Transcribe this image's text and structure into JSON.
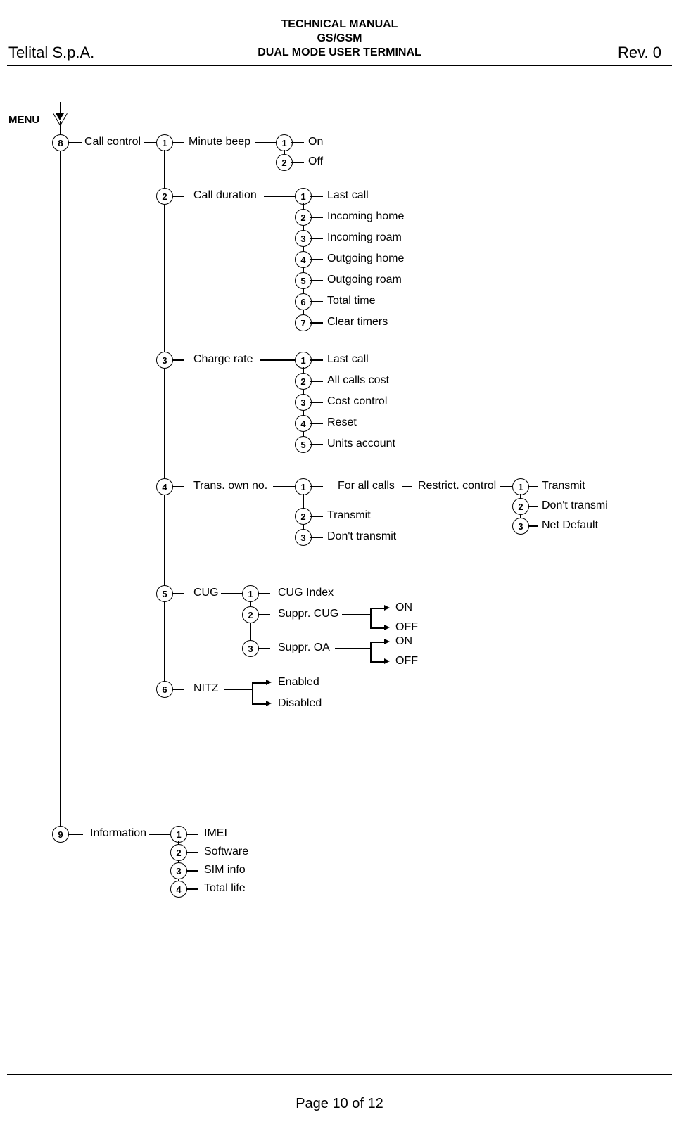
{
  "header": {
    "company": "Telital S.p.A.",
    "title1": "TECHNICAL MANUAL",
    "title2": "GS/GSM",
    "title3": "DUAL MODE USER TERMINAL",
    "rev": "Rev. 0"
  },
  "footer": {
    "page": "Page 10 of 12"
  },
  "menu_label": "MENU",
  "tree": {
    "n8": "8",
    "n8_label": "Call control",
    "cc1": "1",
    "cc1_label": "Minute beep",
    "mb1": "1",
    "mb1_label": "On",
    "mb2": "2",
    "mb2_label": "Off",
    "cc2": "2",
    "cc2_label": "Call duration",
    "cd1": "1",
    "cd1_label": "Last call",
    "cd2": "2",
    "cd2_label": "Incoming home",
    "cd3": "3",
    "cd3_label": "Incoming roam",
    "cd4": "4",
    "cd4_label": "Outgoing home",
    "cd5": "5",
    "cd5_label": "Outgoing roam",
    "cd6": "6",
    "cd6_label": "Total time",
    "cd7": "7",
    "cd7_label": "Clear timers",
    "cc3": "3",
    "cc3_label": "Charge rate",
    "cr1": "1",
    "cr1_label": "Last call",
    "cr2": "2",
    "cr2_label": "All calls cost",
    "cr3": "3",
    "cr3_label": "Cost control",
    "cr4": "4",
    "cr4_label": "Reset",
    "cr5": "5",
    "cr5_label": "Units account",
    "cc4": "4",
    "cc4_label": "Trans. own no.",
    "to1": "1",
    "to1_label": "For all calls",
    "to1_ext": "Restrict. control",
    "rc1": "1",
    "rc1_label": "Transmit",
    "rc2": "2",
    "rc2_label": "Don't transmi",
    "rc3": "3",
    "rc3_label": "Net Default",
    "to2": "2",
    "to2_label": "Transmit",
    "to3": "3",
    "to3_label": "Don't transmit",
    "cc5": "5",
    "cc5_label": "CUG",
    "cu1": "1",
    "cu1_label": "CUG Index",
    "cu2": "2",
    "cu2_label": "Suppr. CUG",
    "cu2_on": "ON",
    "cu2_off": "OFF",
    "cu3": "3",
    "cu3_label": "Suppr. OA",
    "cu3_on": "ON",
    "cu3_off": "OFF",
    "cc6": "6",
    "cc6_label": "NITZ",
    "nitz_on": "Enabled",
    "nitz_off": "Disabled",
    "n9": "9",
    "n9_label": "Information",
    "in1": "1",
    "in1_label": "IMEI",
    "in2": "2",
    "in2_label": "Software",
    "in3": "3",
    "in3_label": "SIM info",
    "in4": "4",
    "in4_label": "Total life"
  }
}
